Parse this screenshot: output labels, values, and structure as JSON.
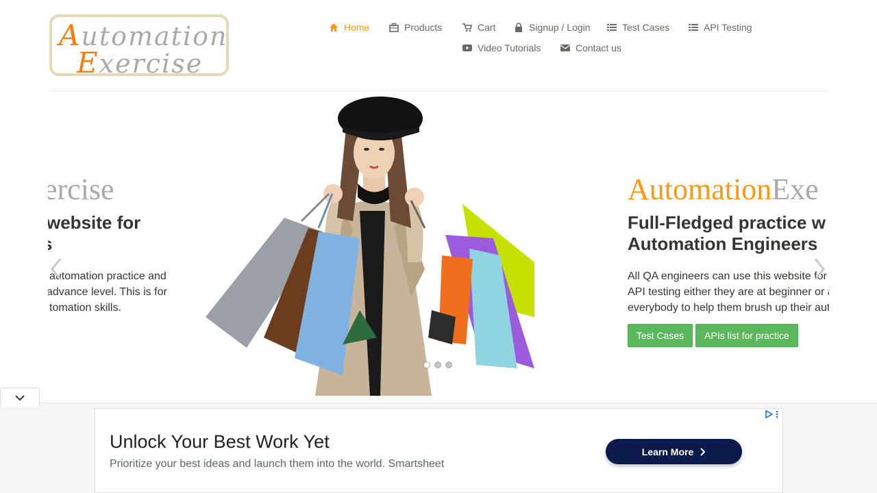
{
  "logo": {
    "line1_cap": "A",
    "line1_rest": "utomation",
    "line2_cap": "E",
    "line2_rest": "xercise"
  },
  "nav": {
    "items": [
      {
        "label": "Home",
        "icon": "home-icon",
        "active": true
      },
      {
        "label": "Products",
        "icon": "products-icon"
      },
      {
        "label": "Cart",
        "icon": "cart-icon"
      },
      {
        "label": "Signup / Login",
        "icon": "lock-icon"
      },
      {
        "label": "Test Cases",
        "icon": "list-icon"
      },
      {
        "label": "API Testing",
        "icon": "list-icon"
      },
      {
        "label": "Video Tutorials",
        "icon": "youtube-icon"
      },
      {
        "label": "Contact us",
        "icon": "envelope-icon"
      }
    ]
  },
  "slider": {
    "left": {
      "brand_tail": "ercise",
      "heading_l1": "website for",
      "heading_l2": "s",
      "para_l1": "automation practice and",
      "para_l2": "advance level. This is for",
      "para_l3": "tomation skills."
    },
    "right": {
      "brand_a": "Automation",
      "brand_b": "Exe",
      "heading_l1": "Full-Fledged practice w",
      "heading_l2": "Automation Engineers",
      "para_l1": "All QA engineers can use this website for",
      "para_l2": "API testing either they are at beginner or a",
      "para_l3": "everybody to help them brush up their aut",
      "btn_test_cases": "Test Cases",
      "btn_apis": "APIs list for practice"
    },
    "dots": 3,
    "active_dot": 0
  },
  "ad": {
    "title": "Unlock Your Best Work Yet",
    "subtitle": "Prioritize your best ideas and launch them into the world. Smartsheet",
    "cta": "Learn More",
    "accent": "#0b1a4a"
  },
  "colors": {
    "brand": "#fe980f",
    "button": "#5cb85c",
    "text": "#363432"
  }
}
